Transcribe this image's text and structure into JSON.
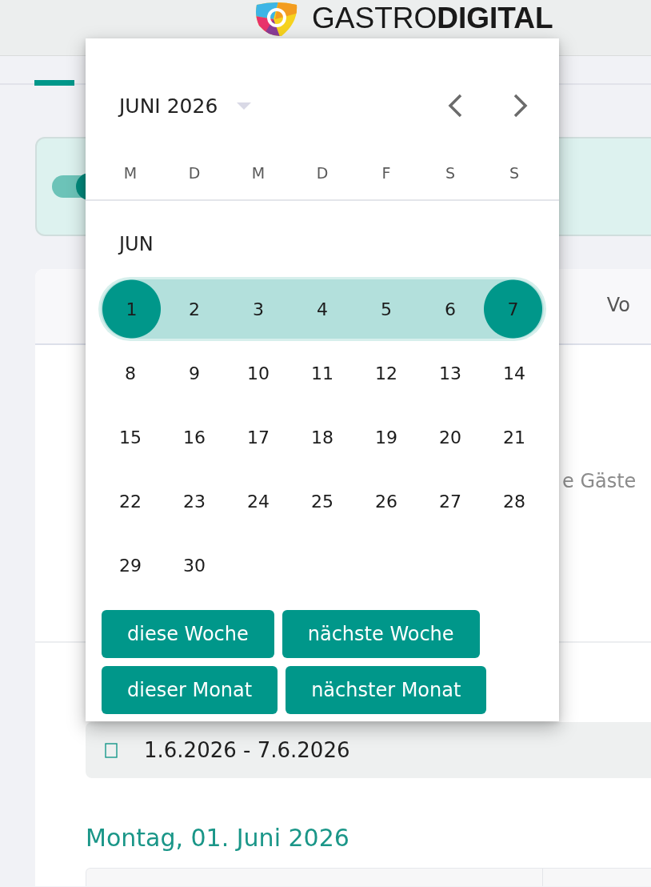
{
  "header": {
    "logo_text": "GASTRO**DIGITAL**"
  },
  "nav_tabs": [
    {
      "selected": true
    }
  ],
  "datepicker": {
    "month_label": "JUNI 2026",
    "weekdays": [
      "M",
      "D",
      "M",
      "D",
      "F",
      "S",
      "S"
    ],
    "section_label": "JUN",
    "weeks": [
      {
        "days": [
          {
            "day": "1",
            "in_range": true,
            "selected": true
          },
          {
            "day": "2",
            "in_range": true,
            "selected": false
          },
          {
            "day": "3",
            "in_range": true,
            "selected": false
          },
          {
            "day": "4",
            "in_range": true,
            "selected": false
          },
          {
            "day": "5",
            "in_range": true,
            "selected": false
          },
          {
            "day": "6",
            "in_range": true,
            "selected": false
          },
          {
            "day": "7",
            "in_range": true,
            "selected": true
          }
        ]
      },
      {
        "days": [
          {
            "day": "8",
            "in_range": false,
            "selected": false
          },
          {
            "day": "9",
            "in_range": false,
            "selected": false
          },
          {
            "day": "10",
            "in_range": false,
            "selected": false
          },
          {
            "day": "11",
            "in_range": false,
            "selected": false
          },
          {
            "day": "12",
            "in_range": false,
            "selected": false
          },
          {
            "day": "13",
            "in_range": false,
            "selected": false
          },
          {
            "day": "14",
            "in_range": false,
            "selected": false
          }
        ]
      },
      {
        "days": [
          {
            "day": "15",
            "in_range": false,
            "selected": false
          },
          {
            "day": "16",
            "in_range": false,
            "selected": false
          },
          {
            "day": "17",
            "in_range": false,
            "selected": false
          },
          {
            "day": "18",
            "in_range": false,
            "selected": false
          },
          {
            "day": "19",
            "in_range": false,
            "selected": false
          },
          {
            "day": "20",
            "in_range": false,
            "selected": false
          },
          {
            "day": "21",
            "in_range": false,
            "selected": false
          }
        ]
      },
      {
        "days": [
          {
            "day": "22",
            "in_range": false,
            "selected": false
          },
          {
            "day": "23",
            "in_range": false,
            "selected": false
          },
          {
            "day": "24",
            "in_range": false,
            "selected": false
          },
          {
            "day": "25",
            "in_range": false,
            "selected": false
          },
          {
            "day": "26",
            "in_range": false,
            "selected": false
          },
          {
            "day": "27",
            "in_range": false,
            "selected": false
          },
          {
            "day": "28",
            "in_range": false,
            "selected": false
          }
        ]
      },
      {
        "days": [
          {
            "day": "29",
            "in_range": false,
            "selected": false
          },
          {
            "day": "30",
            "in_range": false,
            "selected": false
          }
        ]
      }
    ],
    "shortcuts": [
      "diese Woche",
      "nächste Woche",
      "dieser Monat",
      "nächster Monat"
    ]
  },
  "toggle": {
    "on": true
  },
  "panel_tabs": [
    {
      "label": "Vo",
      "selected": false
    }
  ],
  "content": {
    "text": "e Gäste"
  },
  "date_range": {
    "value": "1.6.2026 - 7.6.2026"
  },
  "day_heading": "Montag, 01. Juni 2026"
}
